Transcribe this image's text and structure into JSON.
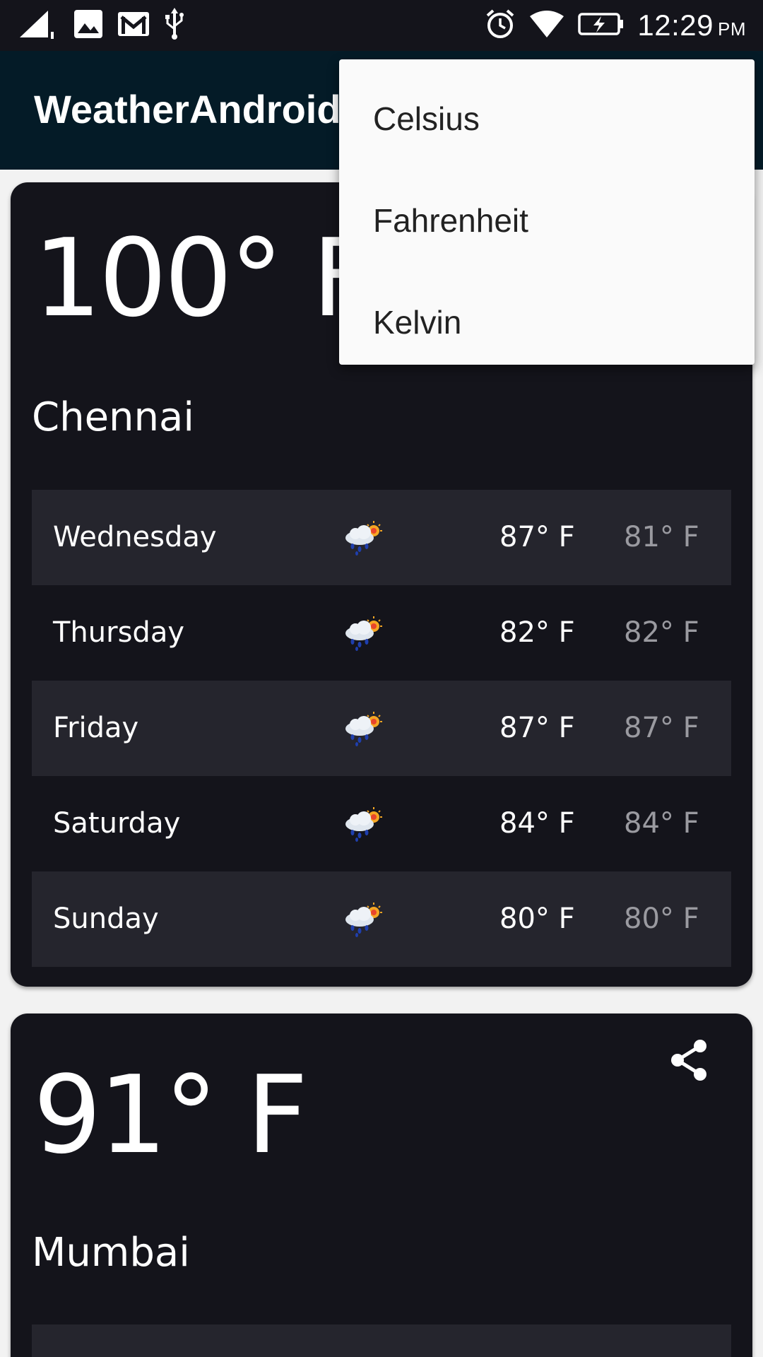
{
  "status_bar": {
    "time": "12:29",
    "ampm": "PM",
    "left_icons": [
      "signal-icon",
      "image-icon",
      "gmail-icon",
      "usb-icon"
    ],
    "right_icons": [
      "alarm-icon",
      "wifi-icon",
      "battery-charging-icon"
    ]
  },
  "app_bar": {
    "title": "WeatherAndroid"
  },
  "menu": {
    "items": [
      {
        "label": "Celsius"
      },
      {
        "label": "Fahrenheit"
      },
      {
        "label": "Kelvin"
      }
    ]
  },
  "cards": [
    {
      "current_temp": "100° F",
      "city": "Chennai",
      "forecast": [
        {
          "day": "Wednesday",
          "icon": "rain-sun-icon",
          "high": "87° F",
          "low": "81° F"
        },
        {
          "day": "Thursday",
          "icon": "rain-sun-icon",
          "high": "82° F",
          "low": "82° F"
        },
        {
          "day": "Friday",
          "icon": "rain-sun-icon",
          "high": "87° F",
          "low": "87° F"
        },
        {
          "day": "Saturday",
          "icon": "rain-sun-icon",
          "high": "84° F",
          "low": "84° F"
        },
        {
          "day": "Sunday",
          "icon": "rain-sun-icon",
          "high": "80° F",
          "low": "80° F"
        }
      ]
    },
    {
      "current_temp": "91° F",
      "city": "Mumbai",
      "share_icon": "share-icon",
      "forecast": []
    }
  ],
  "colors": {
    "status_bar": "#14141b",
    "app_bar": "#041b27",
    "card": "#14141b",
    "row_alt": "#25252d",
    "page_bg": "#f2f2f2",
    "menu_bg": "#fafafa",
    "low_temp": "#9a9aa0"
  }
}
